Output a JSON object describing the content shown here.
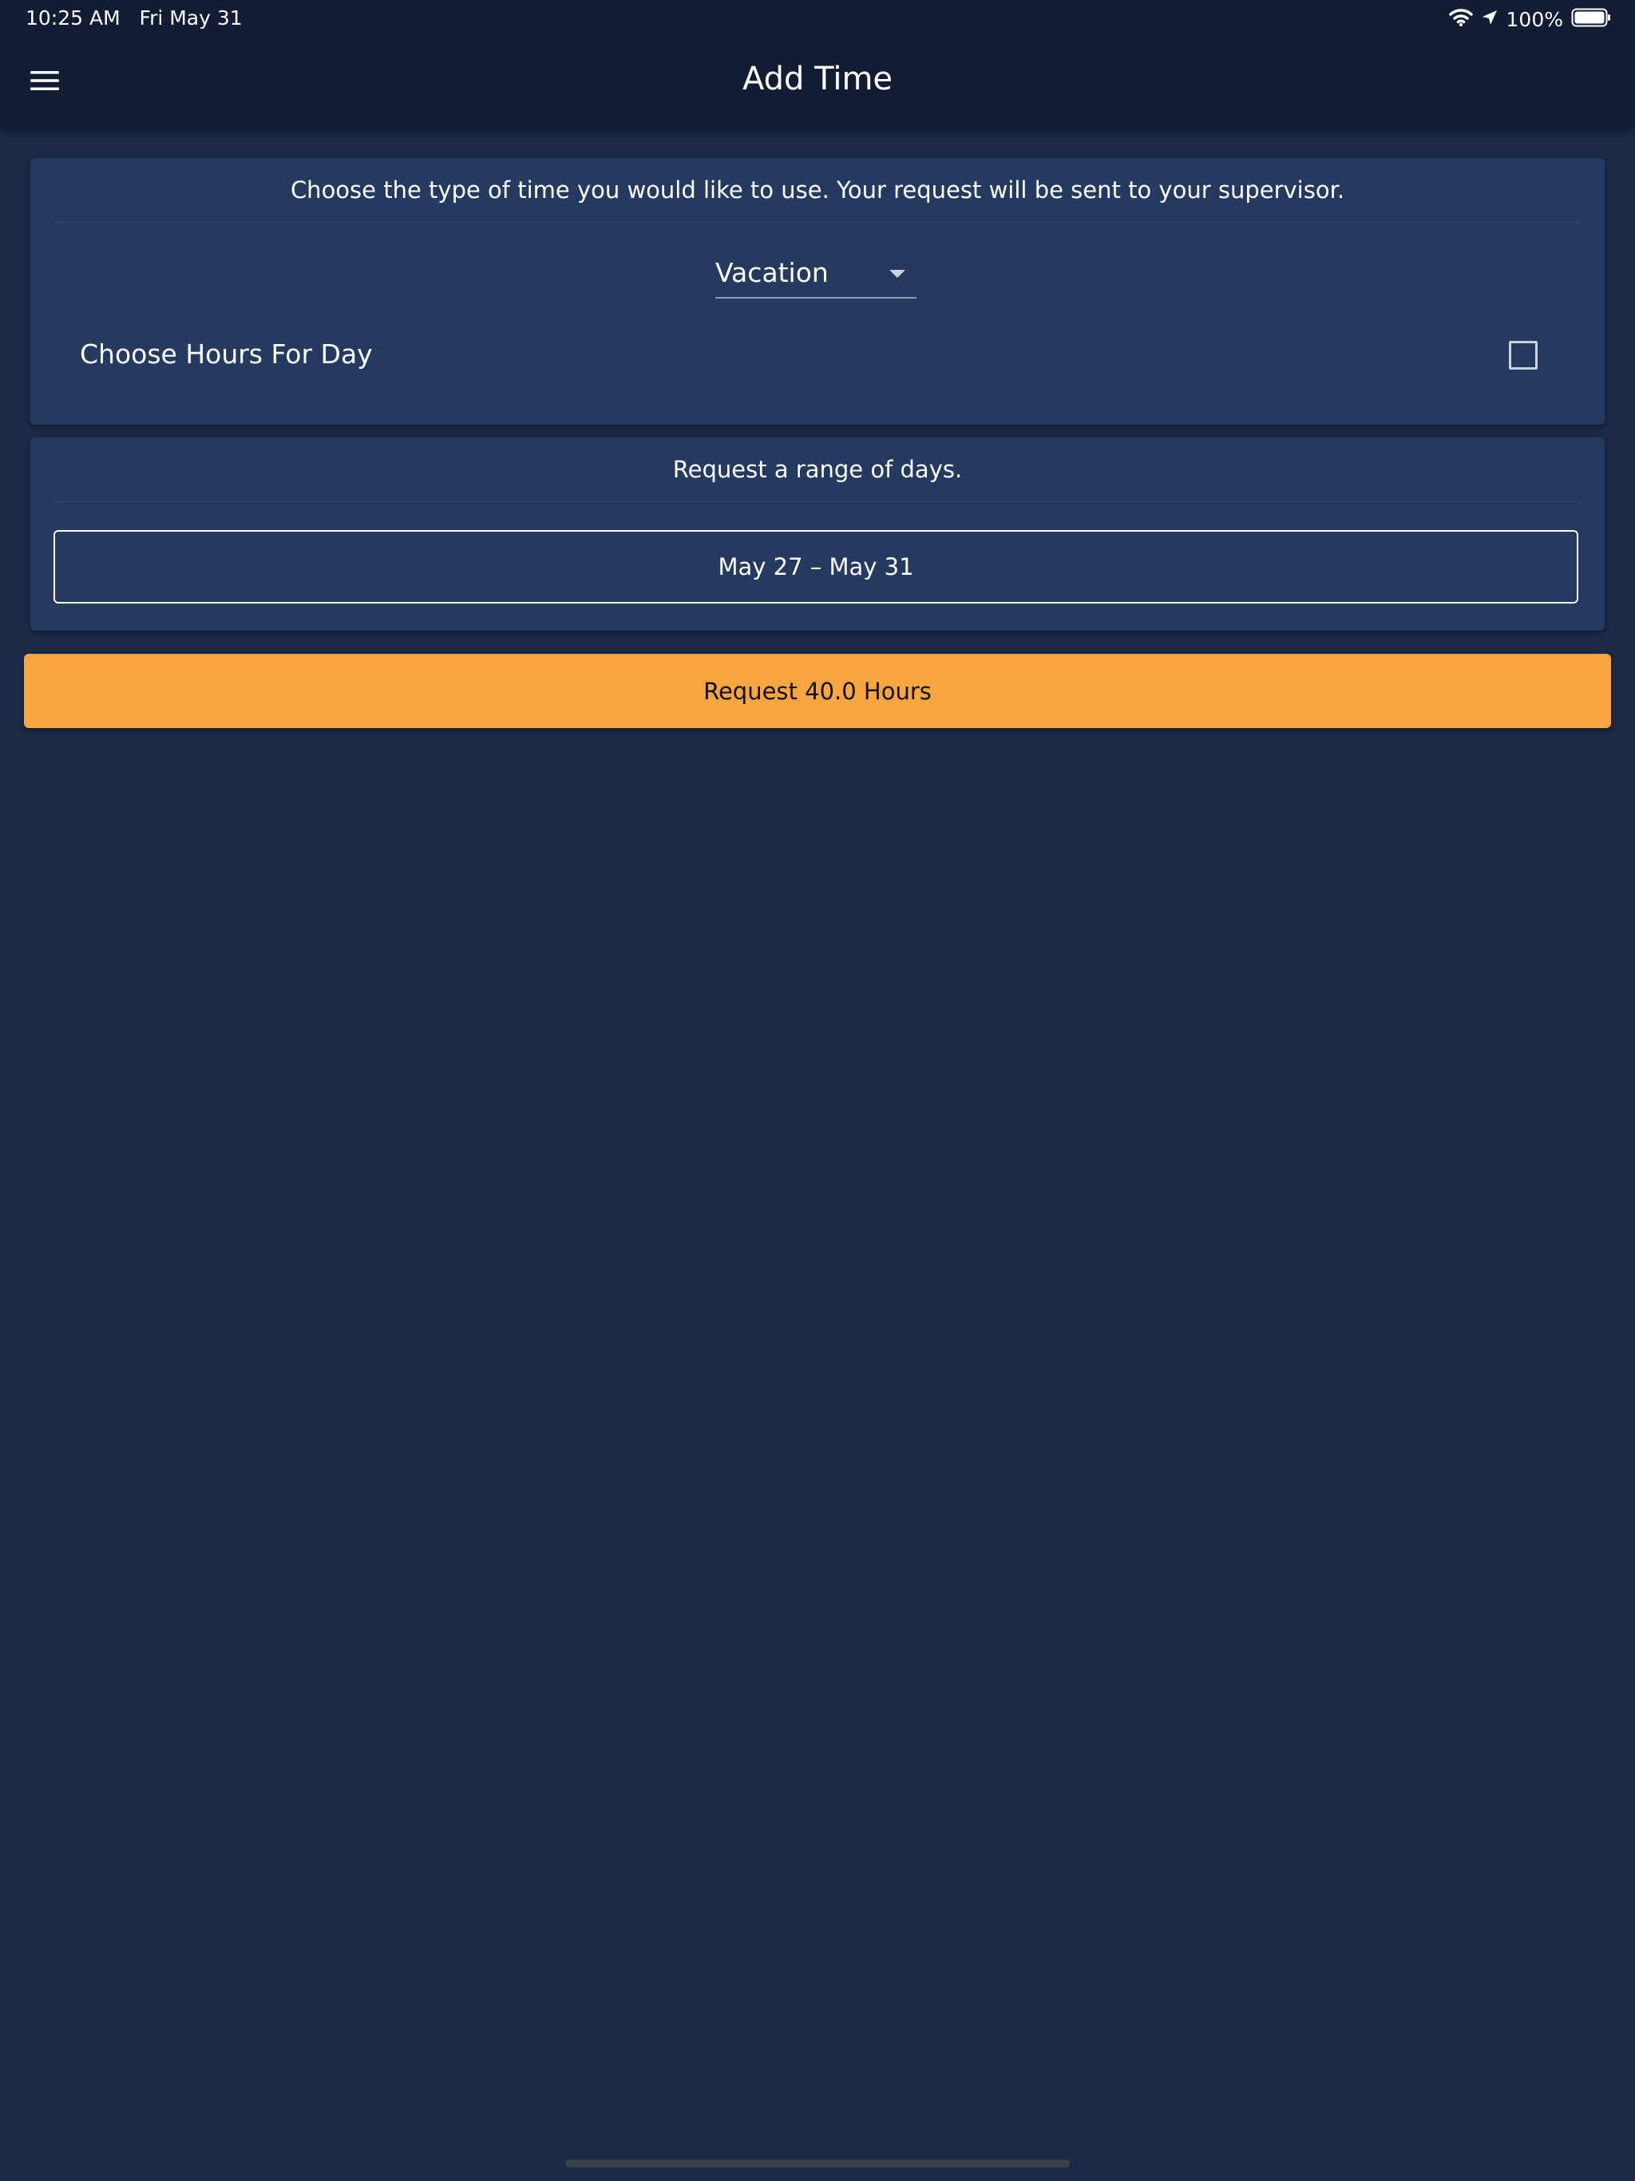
{
  "status_bar": {
    "time": "10:25 AM   Fri May 31",
    "battery": "100%",
    "icons": [
      "wifi-icon",
      "location-arrow-icon",
      "battery-icon"
    ]
  },
  "app_bar": {
    "title": "Add Time",
    "menu_icon": "hamburger-menu-icon"
  },
  "time_type_card": {
    "instruction": "Choose the type of time you would like to use. Your request will be sent to your supervisor.",
    "dropdown_value": "Vacation",
    "hours_label": "Choose Hours For Day",
    "hours_checked": false
  },
  "range_card": {
    "instruction": "Request a range of days.",
    "date_range": "May 27 – May 31"
  },
  "submit": {
    "label": "Request 40.0 Hours"
  },
  "colors": {
    "background": "#1b2a45",
    "app_bar": "#121d33",
    "card": "#243a5e",
    "accent": "#f9a640"
  }
}
